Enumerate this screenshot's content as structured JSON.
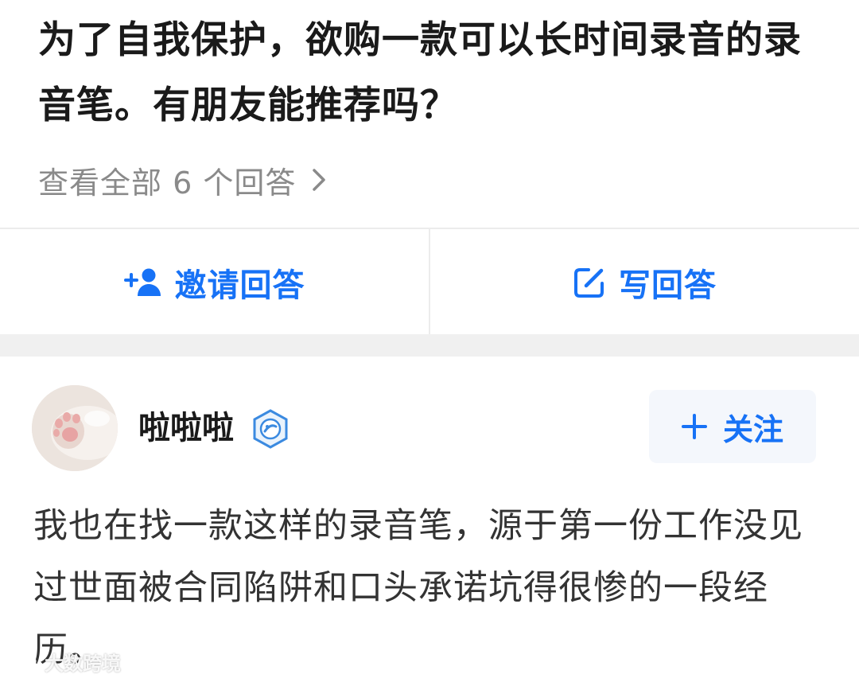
{
  "question": {
    "title": "为了自我保护，欲购一款可以长时间录音的录音笔。有朋友能推荐吗？",
    "view_all_label": "查看全部 6 个回答"
  },
  "actions": {
    "invite_label": "邀请回答",
    "write_label": "写回答"
  },
  "answer": {
    "author_name": "啦啦啦",
    "follow_label": "关注",
    "text": "我也在找一款这样的录音笔，源于第一份工作没见过世面被合同陷阱和口头承诺坑得很惨的一段经历。"
  },
  "watermark": {
    "text": "大数跨境"
  },
  "icons": {
    "chevron": "chevron-right-icon",
    "invite": "add-user-icon",
    "write": "edit-icon",
    "badge": "verified-badge-icon",
    "follow": "plus-icon"
  },
  "colors": {
    "accent": "#1772f6",
    "title_text": "#1a1a1a",
    "secondary_text": "#8a8a8a",
    "body_text": "#333333",
    "divider": "#ececec",
    "section_gap": "#f0f0f0",
    "follow_bg": "#f4f7fc"
  }
}
